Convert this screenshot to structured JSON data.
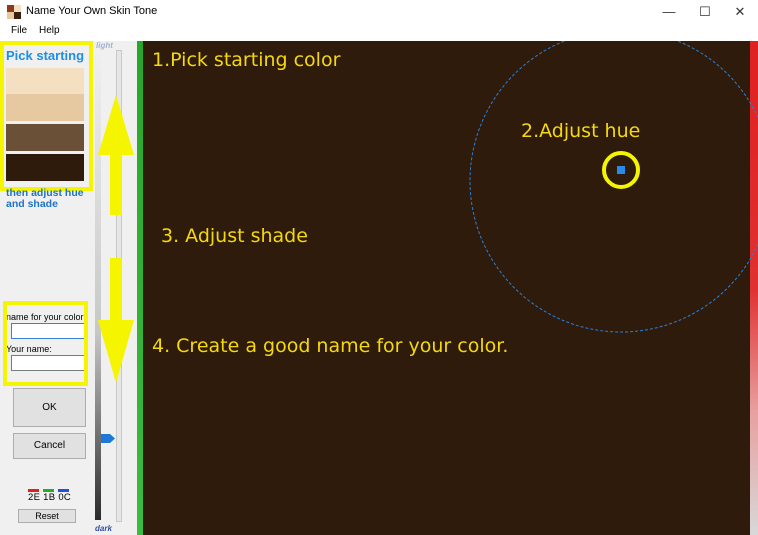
{
  "window": {
    "title": "Name Your Own Skin Tone",
    "controls": [
      "minimize",
      "maximize",
      "close"
    ]
  },
  "menu": [
    "File",
    "Help"
  ],
  "left_panel": {
    "instruction_top": "Pick starting",
    "instruction_bottom": "then adjust hue and shade",
    "swatches": [
      "#f4e0c0",
      "#e6c9a0",
      "#6b5038",
      "#2e1b0c"
    ],
    "name_label": "name for your color",
    "your_name_label": "Your name:",
    "name_value": "",
    "your_name_value": "",
    "ok_label": "OK",
    "cancel_label": "Cancel",
    "hex_value": "2E 1B 0C",
    "reset_label": "Reset"
  },
  "slider": {
    "top_label": "light",
    "bottom_label": "dark",
    "level": 0.82
  },
  "canvas": {
    "color": "#2e1b0c",
    "annotations": {
      "step1": "1.Pick starting color",
      "step2": "2.Adjust hue",
      "step3": "3. Adjust shade",
      "step4": "4. Create a good name for your color."
    }
  },
  "colors": {
    "highlight": "#f5f500",
    "accent_blue": "#1e8ee6",
    "annotation_yellow": "#f5d90a"
  }
}
